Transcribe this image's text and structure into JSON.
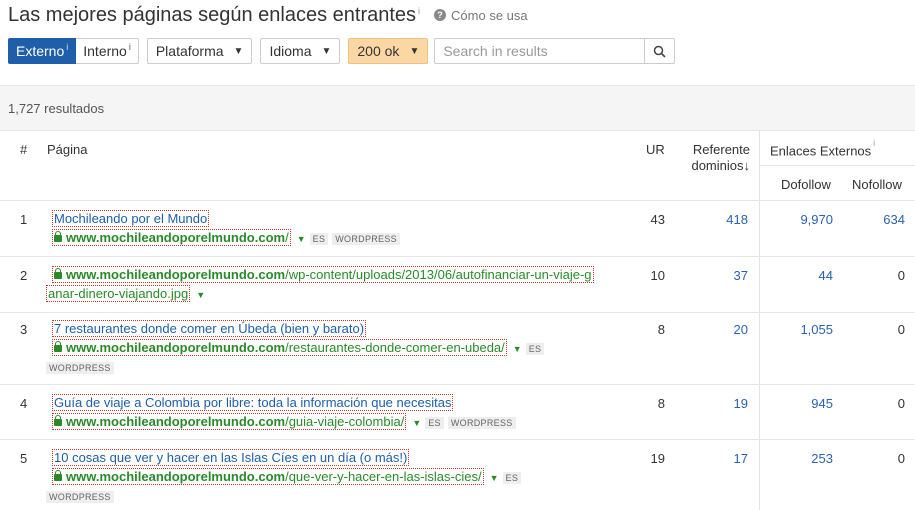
{
  "header": {
    "title": "Las mejores páginas según enlaces entrantes",
    "title_sup": "i",
    "help_label": "Cómo se usa"
  },
  "filters": {
    "externo": "Externo",
    "externo_sup": "i",
    "interno": "Interno",
    "interno_sup": "i",
    "plataforma": "Plataforma",
    "idioma": "Idioma",
    "status": "200 ok",
    "search_placeholder": "Search in results"
  },
  "results_count": "1,727 resultados",
  "columns": {
    "index": "#",
    "page": "Página",
    "ur": "UR",
    "ref_line1": "Referente",
    "ref_line2": "dominios",
    "sort_arrow": "↓",
    "ext_group": "Enlaces Externos",
    "ext_sup": "i",
    "dofollow": "Dofollow",
    "nofollow": "Nofollow"
  },
  "rows": [
    {
      "n": "1",
      "title": "Mochileando por el Mundo",
      "domain": "www.mochileandoporelmundo.com",
      "path": "/",
      "path2": "",
      "lang": "ES",
      "platform": "WORDPRESS",
      "ur": "43",
      "ref": "418",
      "dofollow": "9,970",
      "nofollow": "634"
    },
    {
      "n": "2",
      "title": "",
      "domain": "www.mochileandoporelmundo.com",
      "path": "/wp-content/uploads/2013/06/autofinanciar-un-viaje-g",
      "path2": "anar-dinero-viajando.jpg",
      "lang": "",
      "platform": "",
      "ur": "10",
      "ref": "37",
      "dofollow": "44",
      "nofollow": "0"
    },
    {
      "n": "3",
      "title": "7 restaurantes donde comer en Úbeda (bien y barato)",
      "domain": "www.mochileandoporelmundo.com",
      "path": "/restaurantes-donde-comer-en-ubeda/",
      "path2": "",
      "lang": "ES",
      "platform": "WORDPRESS",
      "ur": "8",
      "ref": "20",
      "dofollow": "1,055",
      "nofollow": "0"
    },
    {
      "n": "4",
      "title": "Guía de viaje a Colombia por libre: toda la información que necesitas",
      "domain": "www.mochileandoporelmundo.com",
      "path": "/guia-viaje-colombia/",
      "path2": "",
      "lang": "ES",
      "platform": "WORDPRESS",
      "ur": "8",
      "ref": "19",
      "dofollow": "945",
      "nofollow": "0"
    },
    {
      "n": "5",
      "title": "10 cosas que ver y hacer en las Islas Cíes en un día (o más!)",
      "domain": "www.mochileandoporelmundo.com",
      "path": "/que-ver-y-hacer-en-las-islas-cies/",
      "path2": "",
      "lang": "ES",
      "platform": "WORDPRESS",
      "ur": "19",
      "ref": "17",
      "dofollow": "253",
      "nofollow": "0"
    }
  ],
  "colors": {
    "accent": "#1f5ea8",
    "link": "#2a62b0",
    "url_green": "#2a8a2a",
    "status_filter": "#fbd7a3"
  }
}
